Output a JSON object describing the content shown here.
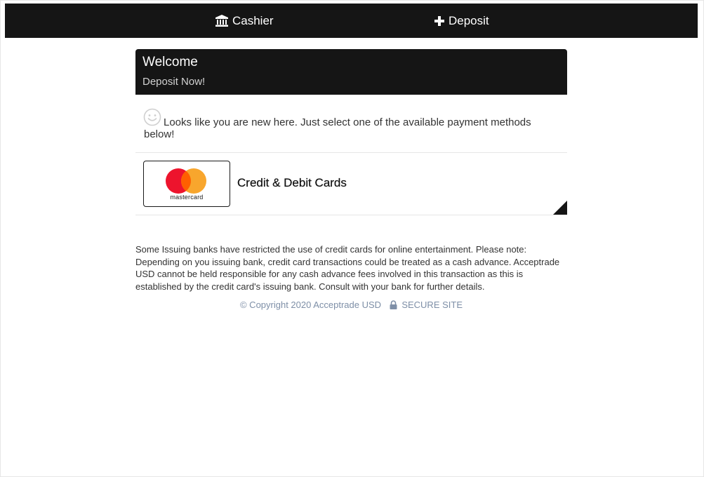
{
  "nav": {
    "cashier_label": "Cashier",
    "deposit_label": "Deposit"
  },
  "welcome": {
    "title": "Welcome",
    "subtitle": "Deposit Now!"
  },
  "intro": {
    "text": "Looks like you are new here. Just select one of the available payment methods below!"
  },
  "payment_methods": [
    {
      "logo_text": "mastercard",
      "label": "Credit & Debit Cards"
    }
  ],
  "disclaimer": "Some Issuing banks have restricted the use of credit cards for online entertainment. Please note: Depending on you issuing bank, credit card transactions could be treated as a cash advance. Acceptrade USD cannot be held responsible for any cash advance fees involved in this transaction as this is established by the credit card's issuing bank. Consult with your bank for further details.",
  "footer": {
    "copyright": "© Copyright 2020 Acceptrade USD",
    "secure_label": "SECURE SITE"
  },
  "colors": {
    "nav_bg": "#151515",
    "mastercard_red": "#eb001b",
    "mastercard_orange": "#f79e1b",
    "footer_text": "#7e8fa7"
  }
}
